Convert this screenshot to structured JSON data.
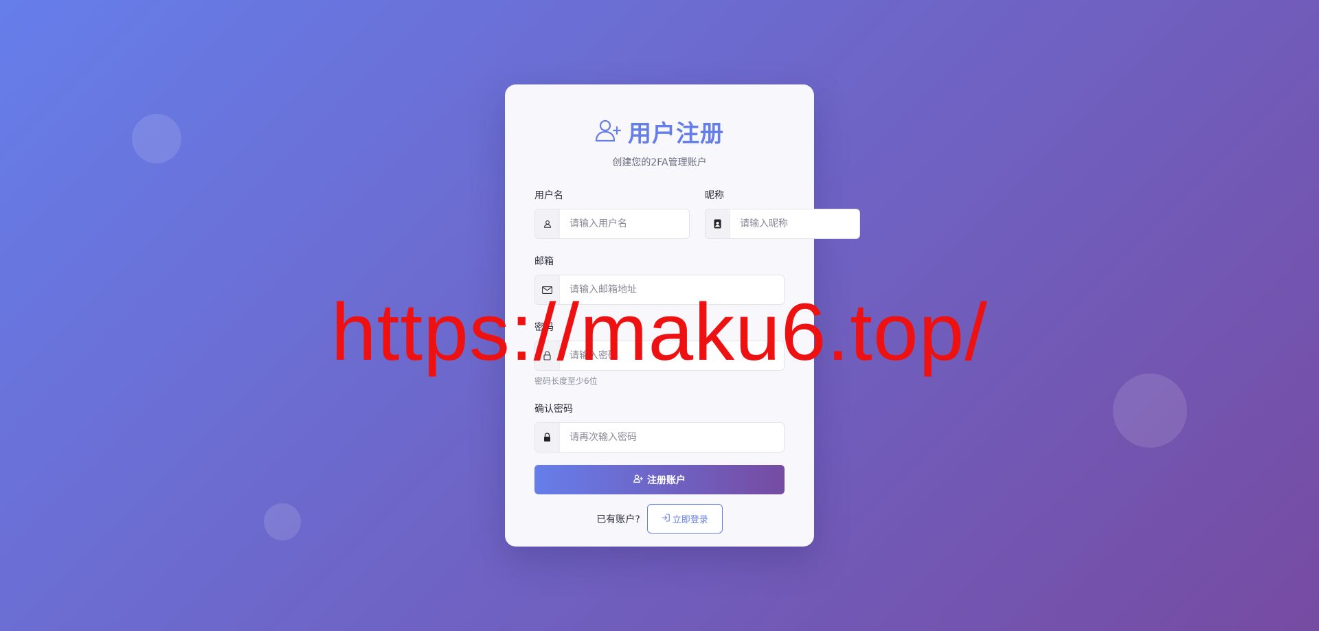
{
  "header": {
    "title": "用户注册",
    "subtitle": "创建您的2FA管理账户",
    "icon": "user-plus-icon"
  },
  "form": {
    "username": {
      "label": "用户名",
      "placeholder": "请输入用户名",
      "value": "",
      "icon": "user-icon"
    },
    "nickname": {
      "label": "昵称",
      "placeholder": "请输入昵称",
      "value": "",
      "icon": "id-badge-icon"
    },
    "email": {
      "label": "邮箱",
      "placeholder": "请输入邮箱地址",
      "value": "",
      "icon": "envelope-icon"
    },
    "password": {
      "label": "密码",
      "placeholder": "请输入密码",
      "value": "",
      "hint": "密码长度至少6位",
      "icon": "lock-icon"
    },
    "confirm_password": {
      "label": "确认密码",
      "placeholder": "请再次输入密码",
      "value": "",
      "icon": "lock-icon"
    },
    "submit_label": "注册账户"
  },
  "footer": {
    "text": "已有账户?",
    "login_label": "立即登录"
  },
  "watermark": "https://maku6.top/",
  "colors": {
    "accent": "#667eea",
    "gradient_start": "#667eea",
    "gradient_end": "#764ba2",
    "watermark": "#ee1111"
  }
}
